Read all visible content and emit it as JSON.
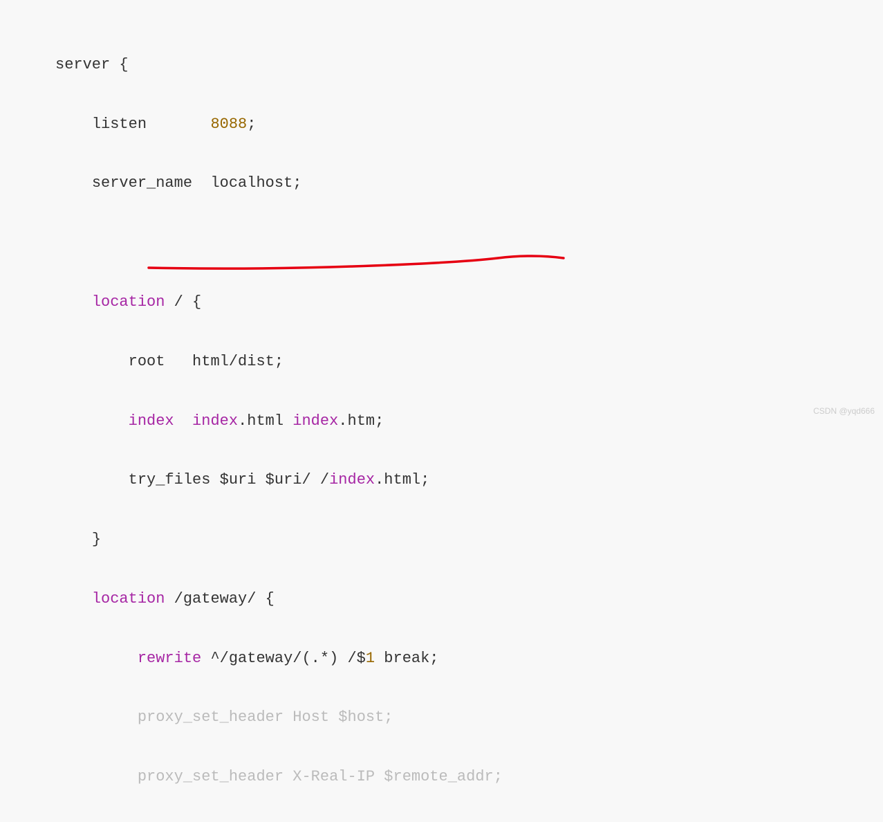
{
  "code": {
    "l1_server": "server",
    "l1_brace": " {",
    "l2_listen": "listen",
    "l2_spaces": "       ",
    "l2_port": "8088",
    "l2_semi": ";",
    "l3_servername": "server_name",
    "l3_spaces": "  ",
    "l3_value": "localhost;",
    "l5_location": "location",
    "l5_path": " / {",
    "l6_root": "root",
    "l6_spaces": "   ",
    "l6_value": "html/dist;",
    "l7_index": "index",
    "l7_spaces": "  ",
    "l7_index1": "index",
    "l7_dot1": ".html ",
    "l7_index2": "index",
    "l7_dot2": ".htm;",
    "l8_tryfiles": "try_files ",
    "l8_uri1": "$uri",
    "l8_sp1": " ",
    "l8_uri2": "$uri",
    "l8_slash": "/ /",
    "l8_index": "index",
    "l8_html": ".html;",
    "l9_brace": "}",
    "l10_location": "location",
    "l10_path": " /gateway/ {",
    "l11_rewrite": "rewrite",
    "l11_rest": " ^/gateway/(.*) /$",
    "l11_one": "1",
    "l11_break": " break;",
    "l12_proxy": "proxy_",
    "l12_set": "set",
    "l12_rest": "_header Host $host;",
    "l13_proxy": "proxy_",
    "l13_set": "set",
    "l13_rest": "_header X-Real-IP $remote_addr;"
  },
  "watermark": "CSDN @yqd666"
}
